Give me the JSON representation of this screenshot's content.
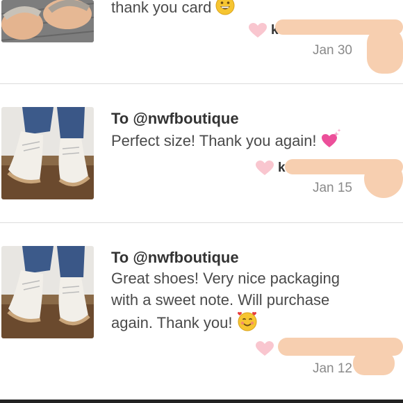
{
  "reviews": [
    {
      "to": "",
      "text": "thank you card",
      "emoji": "grinning-face",
      "user": "k",
      "date": "Jan 30",
      "image": "sandals-photo"
    },
    {
      "to": "To @nwfboutique",
      "text": "Perfect size! Thank you again!",
      "emoji": "sparkling-heart",
      "user": "k",
      "date": "Jan 15",
      "image": "white-sneakers-photo"
    },
    {
      "to": "To @nwfboutique",
      "text_lines": [
        "Great shoes! Very nice packaging",
        "with a sweet note. Will purchase",
        "again. Thank you!"
      ],
      "emoji": "smiling-face-with-hearts",
      "user": "",
      "date": "Jan 12",
      "image": "white-sneakers-photo"
    }
  ],
  "colors": {
    "heart": "#f9c6cf",
    "redaction": "#f7cfb0",
    "divider": "#dcdcdc",
    "date": "#8a8a8a"
  }
}
